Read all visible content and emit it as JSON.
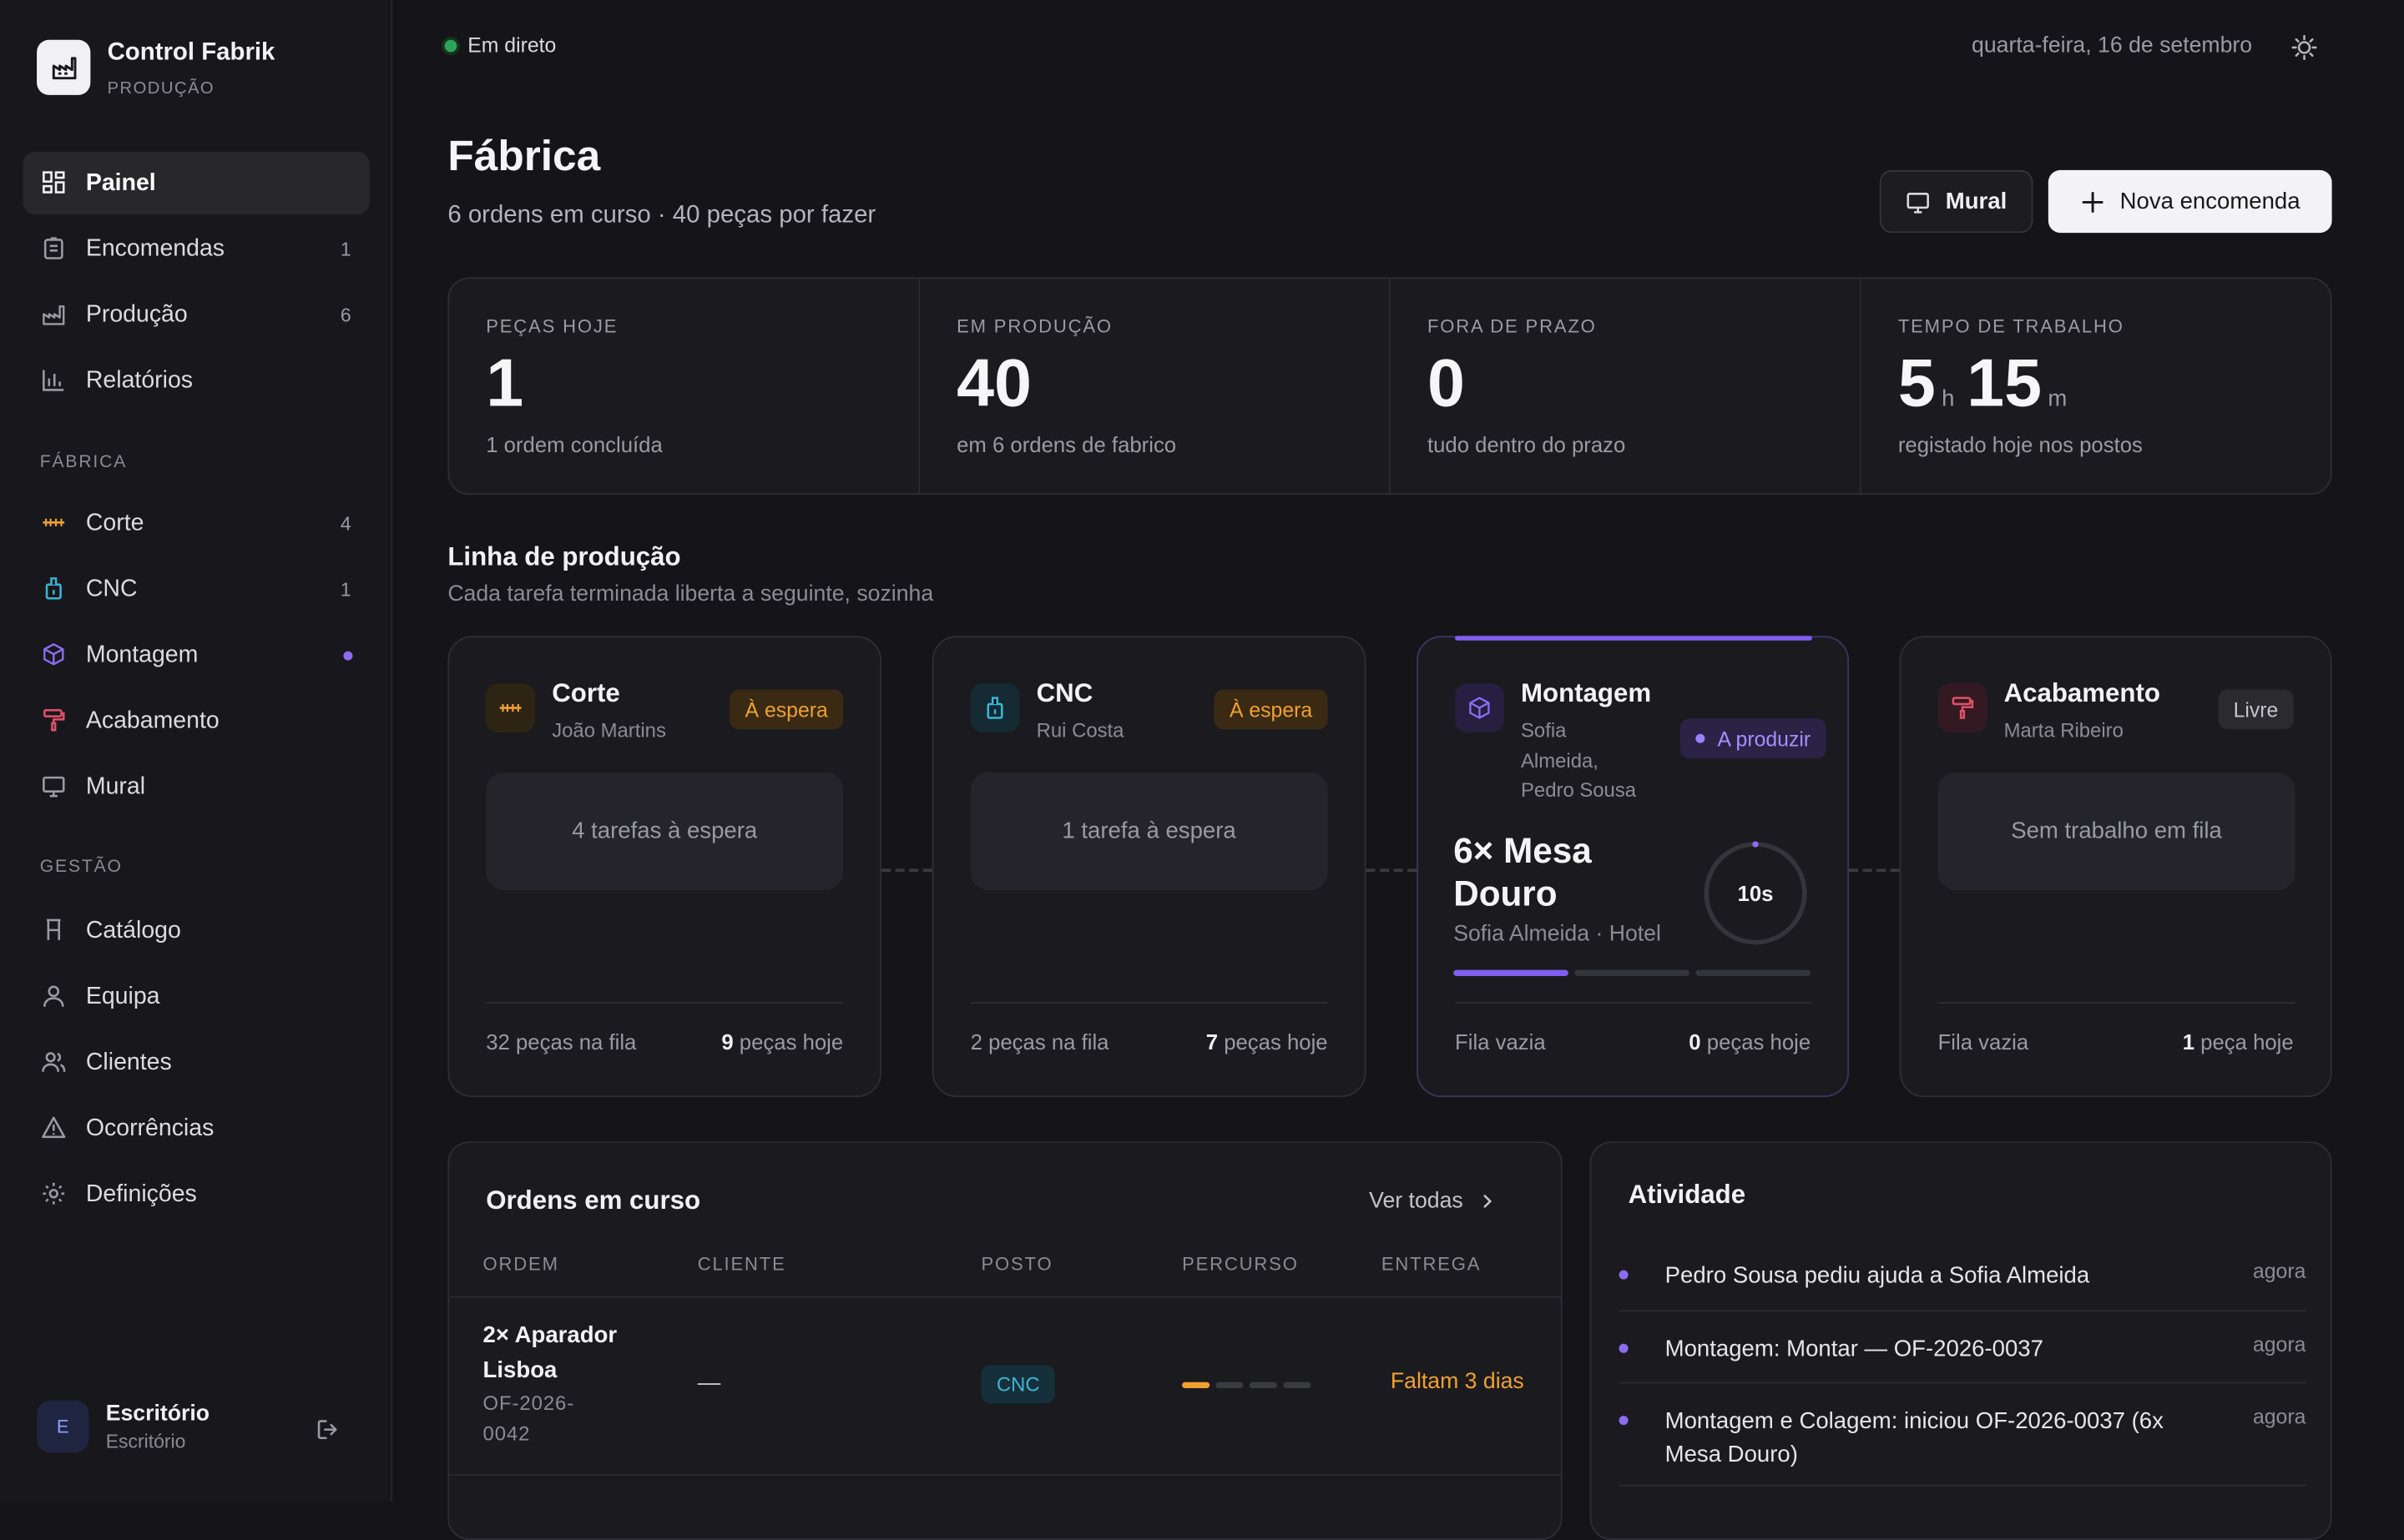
{
  "sidebar": {
    "brand_title": "Control Fabrik",
    "brand_sub": "PRODUÇÃO",
    "nav": [
      {
        "label": "Painel",
        "count": ""
      },
      {
        "label": "Encomendas",
        "count": "1"
      },
      {
        "label": "Produção",
        "count": "6"
      },
      {
        "label": "Relatórios",
        "count": ""
      }
    ],
    "section_fabrica": "FÁBRICA",
    "fabrica": [
      {
        "label": "Corte",
        "count": "4",
        "color": "#f0a030"
      },
      {
        "label": "CNC",
        "count": "1",
        "color": "#3bb4d8"
      },
      {
        "label": "Montagem",
        "count": "",
        "color": "#8b6cf2"
      },
      {
        "label": "Acabamento",
        "count": "",
        "color": "#e0506a"
      },
      {
        "label": "Mural",
        "count": ""
      }
    ],
    "section_gestao": "GESTÃO",
    "gestao": [
      {
        "label": "Catálogo"
      },
      {
        "label": "Equipa"
      },
      {
        "label": "Clientes"
      },
      {
        "label": "Ocorrências"
      },
      {
        "label": "Definições"
      }
    ],
    "user": {
      "initial": "E",
      "name": "Escritório",
      "role": "Escritório"
    }
  },
  "header": {
    "live": "Em direto",
    "date": "quarta-feira, 16 de setembro",
    "title": "Fábrica",
    "subtitle": "6 ordens em curso · 40 peças por fazer",
    "btn_mural": "Mural",
    "btn_new": "Nova encomenda"
  },
  "stats": [
    {
      "label": "PEÇAS HOJE",
      "value": "1",
      "note": "1 ordem concluída"
    },
    {
      "label": "EM PRODUÇÃO",
      "value": "40",
      "note": "em 6 ordens de fabrico"
    },
    {
      "label": "FORA DE PRAZO",
      "value": "0",
      "note": "tudo dentro do prazo"
    },
    {
      "label": "TEMPO DE TRABALHO",
      "hours": "5",
      "h_unit": "h",
      "minutes": "15",
      "m_unit": "m",
      "note": "registado hoje nos postos"
    }
  ],
  "line": {
    "title": "Linha de produção",
    "subtitle": "Cada tarefa terminada liberta a seguinte, sozinha",
    "stations": [
      {
        "name": "Corte",
        "person": "João Martins",
        "status": "À espera",
        "queue": "4 tarefas à espera",
        "foot_left": "32 peças na fila",
        "foot_num": "9",
        "foot_right": " peças hoje",
        "color": "#f0a030"
      },
      {
        "name": "CNC",
        "person": "Rui Costa",
        "status": "À espera",
        "queue": "1 tarefa à espera",
        "foot_left": "2 peças na fila",
        "foot_num": "7",
        "foot_right": " peças hoje",
        "color": "#3bb4d8"
      },
      {
        "name": "Montagem",
        "person_lines": [
          "Sofia",
          "Almeida,",
          "Pedro Sousa"
        ],
        "status": "A produzir",
        "job": "6× Mesa Douro",
        "job_meta": "Sofia Almeida · Hotel",
        "timer": "10s",
        "steps_done": 1,
        "steps_total": 3,
        "foot_left": "Fila vazia",
        "foot_num": "0",
        "foot_right": " peças hoje",
        "color": "#8b6cf2"
      },
      {
        "name": "Acabamento",
        "person": "Marta Ribeiro",
        "status": "Livre",
        "queue": "Sem trabalho em fila",
        "foot_left": "Fila vazia",
        "foot_num": "1",
        "foot_right": " peça hoje",
        "color": "#e0506a"
      }
    ]
  },
  "orders": {
    "title": "Ordens em curso",
    "see_all": "Ver todas",
    "columns": [
      "ORDEM",
      "CLIENTE",
      "POSTO",
      "PERCURSO",
      "ENTREGA"
    ],
    "rows": [
      {
        "name": "2× Aparador Lisboa",
        "code": "OF-2026-0042",
        "client": "—",
        "post": "CNC",
        "route_done": 1,
        "route_total": 4,
        "due": "Faltam 3 dias"
      }
    ]
  },
  "activity": {
    "title": "Atividade",
    "items": [
      {
        "text": "Pedro Sousa pediu ajuda a Sofia Almeida",
        "time": "agora"
      },
      {
        "text": "Montagem: Montar — OF-2026-0037",
        "time": "agora"
      },
      {
        "text": "Montagem e Colagem: iniciou OF-2026-0037 (6x Mesa Douro)",
        "time": "agora"
      }
    ]
  }
}
